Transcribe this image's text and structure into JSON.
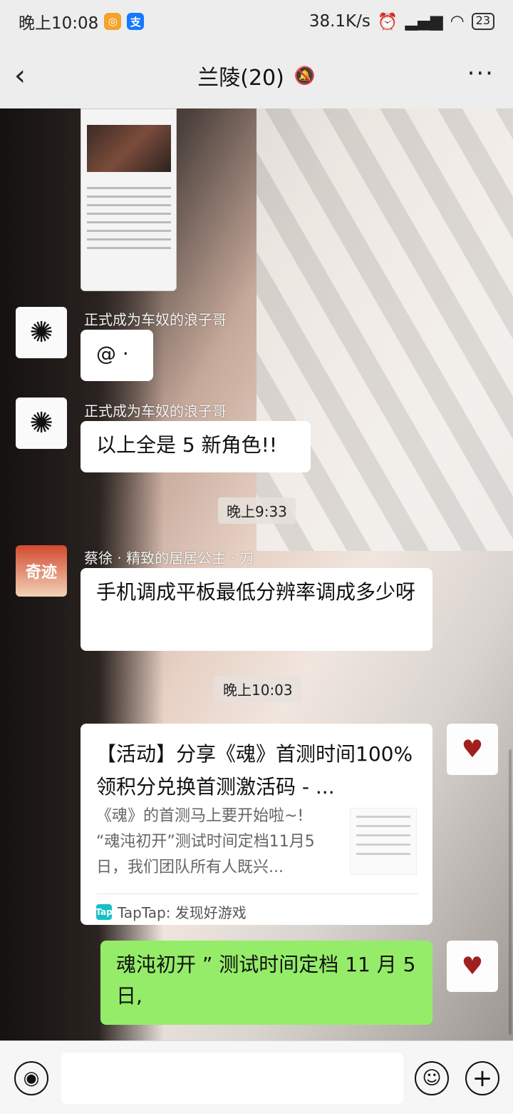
{
  "status": {
    "time": "晚上10:08",
    "speed": "38.1K/s",
    "battery": "23"
  },
  "header": {
    "back_icon": "‹",
    "title": "兰陵(20)",
    "mute_icon": "🔕",
    "more_icon": "···"
  },
  "messages": [
    {
      "type": "text",
      "sender": "正式成为车奴的浪子哥",
      "text": "@ ·"
    },
    {
      "type": "text",
      "sender": "正式成为车奴的浪子哥",
      "text": "以上全是 5 新角色!!"
    },
    {
      "type": "time",
      "text": "晚上9:33"
    },
    {
      "type": "text",
      "sender": "蔡徐 · 精致的居居公主 · 刀",
      "text": "手机调成平板最低分辨率调成多少呀"
    },
    {
      "type": "time",
      "text": "晚上10:03"
    },
    {
      "type": "card",
      "title": "【活动】分享《魂》首测时间100%领积分兑换首测激活码 - ...",
      "desc": "《魂》的首测马上要开始啦~! “魂沌初开”测试时间定档11月5日，我们团队所有人既兴...",
      "source": "TapTap: 发现好游戏",
      "source_icon": "Tap"
    },
    {
      "type": "text_self",
      "text": "魂沌初开 ” 测试时间定档 11 月 5 日,"
    }
  ],
  "avatars": {
    "boy_icon": "✺",
    "red_text": "奇迹",
    "chibi_icon": "♥"
  },
  "input_bar": {
    "voice_icon": "◉",
    "emoji_icon": "☺",
    "plus_icon": "+"
  }
}
